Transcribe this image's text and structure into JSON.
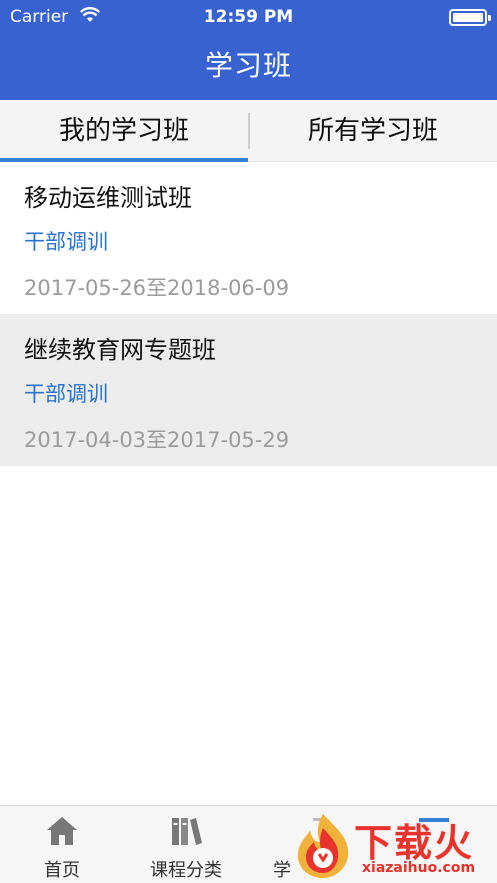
{
  "status_bar": {
    "carrier": "Carrier",
    "time": "12:59 PM"
  },
  "nav": {
    "title": "学习班"
  },
  "tabs": {
    "left": "我的学习班",
    "right": "所有学习班"
  },
  "courses": [
    {
      "name": "移动运维测试班",
      "type": "干部调训",
      "dates": "2017-05-26至2018-06-09"
    },
    {
      "name": "继续教育网专题班",
      "type": "干部调训",
      "dates": "2017-04-03至2017-05-29"
    }
  ],
  "tabbar": {
    "home": "首页",
    "categories": "课程分类",
    "study": "学"
  },
  "watermark": {
    "brand": "下载火",
    "site": "xiazaihuo.com"
  },
  "colors": {
    "header": "#3762cf",
    "accent": "#2a72cf",
    "watermark": "#e8342c"
  }
}
